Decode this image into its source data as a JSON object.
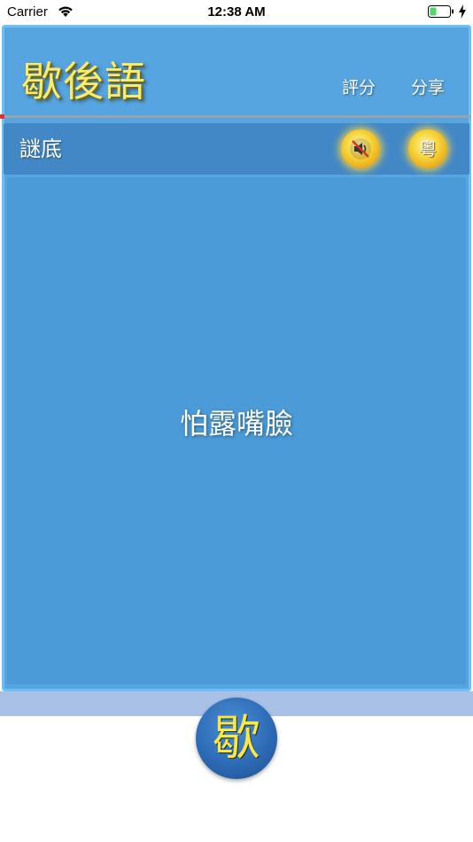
{
  "status_bar": {
    "carrier": "Carrier",
    "time": "12:38 AM"
  },
  "header": {
    "app_title": "歇後語",
    "rate_label": "評分",
    "share_label": "分享"
  },
  "answer_bar": {
    "label": "謎底",
    "sound_button_icon": "speaker-muted-icon",
    "cantonese_button_label": "粵"
  },
  "content": {
    "answer_text": "怕露嘴臉"
  },
  "footer": {
    "logo_glyph": "歇"
  },
  "colors": {
    "panel_blue": "#56a5e0",
    "answer_bar_blue": "#4388c6",
    "content_blue": "#4a9bd8",
    "title_yellow": "#f8ec6c",
    "button_gold": "#f6d53a",
    "strip_lavender": "#a9c0e7",
    "battery_green": "#4cd964"
  }
}
